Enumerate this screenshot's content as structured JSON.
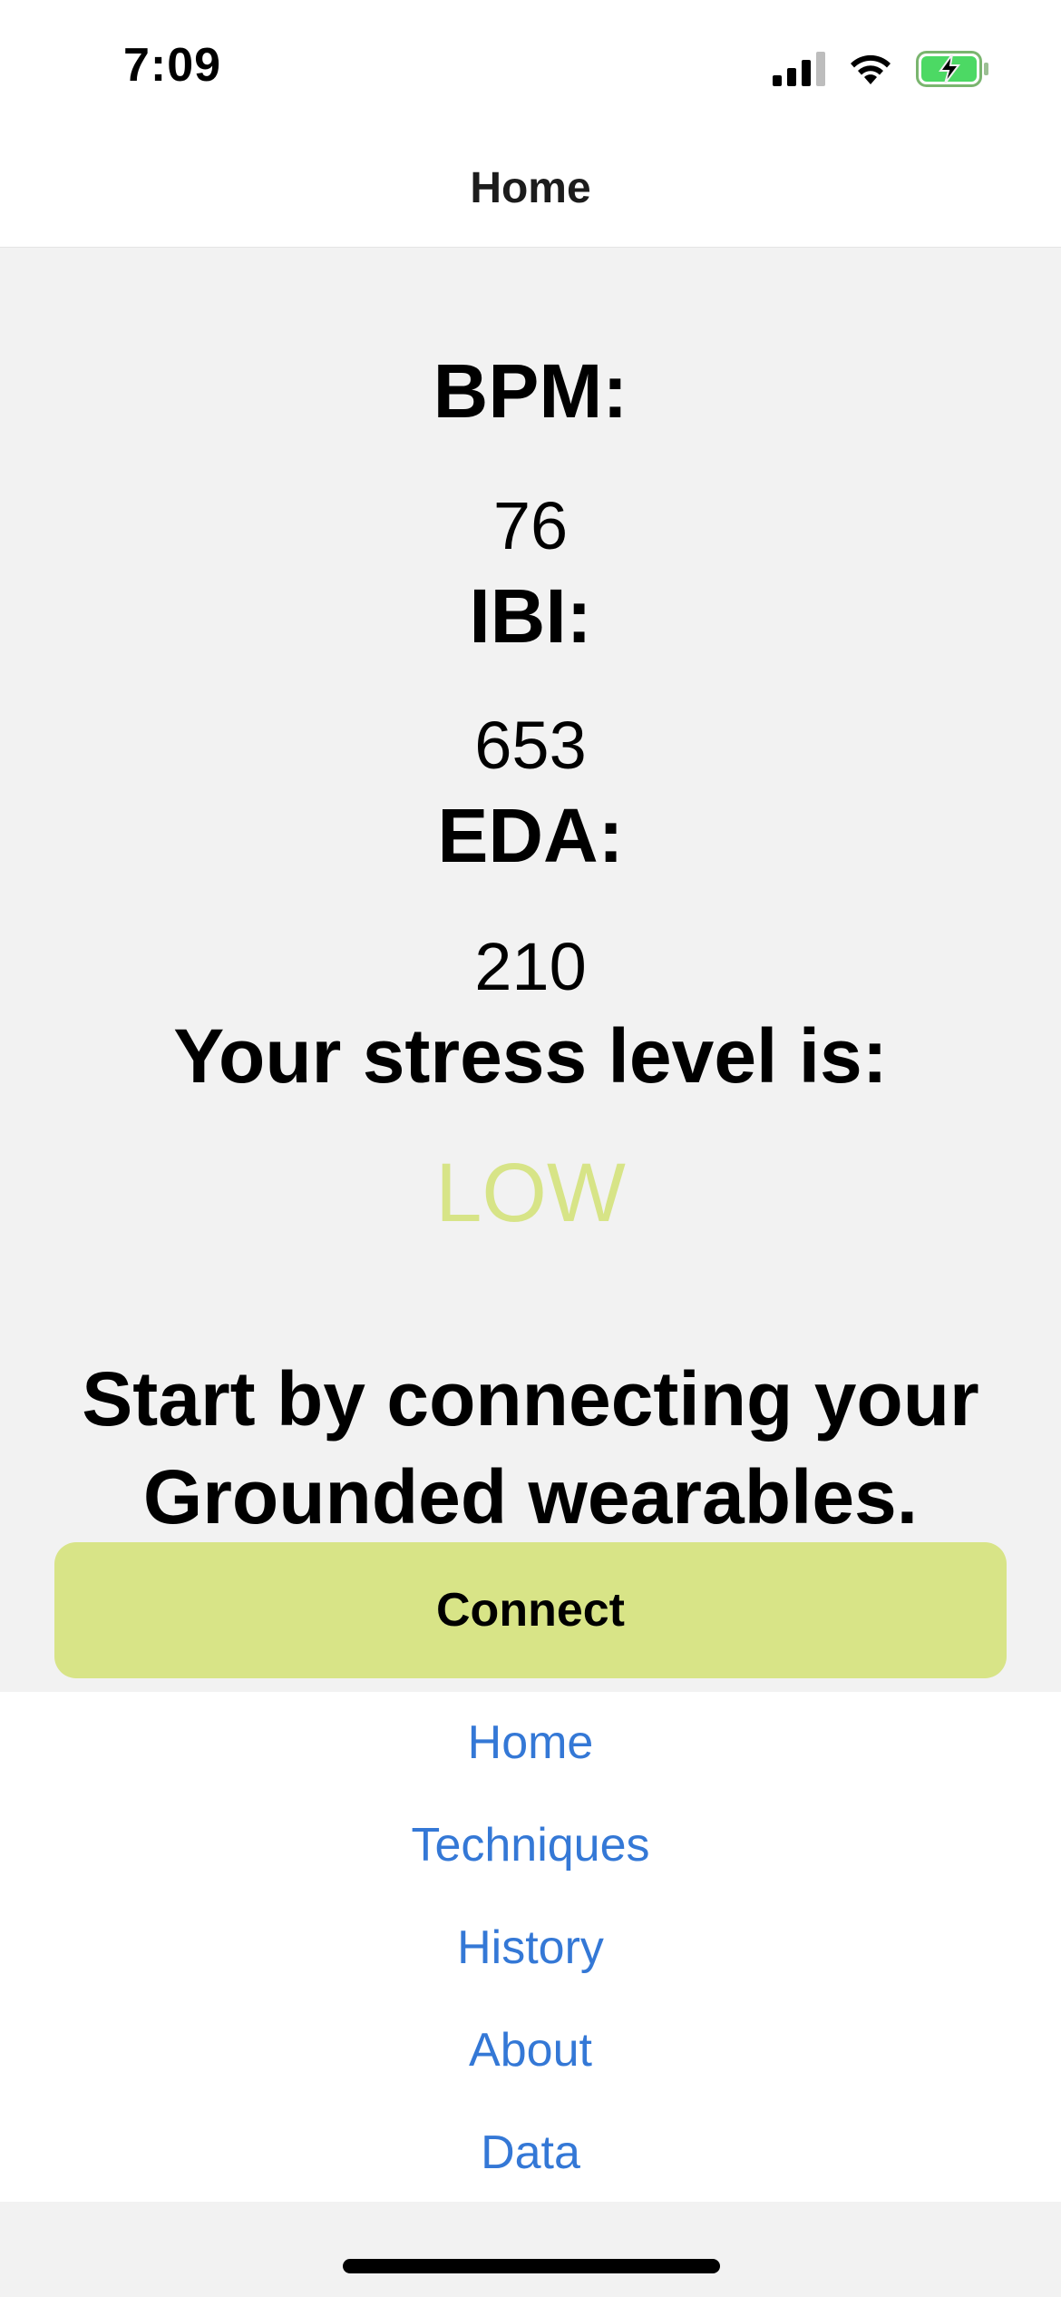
{
  "status_bar": {
    "time": "7:09",
    "signal_icon": "cellular-signal-icon",
    "wifi_icon": "wifi-icon",
    "battery_icon": "battery-charging-icon",
    "battery_color": "#4cd964"
  },
  "header": {
    "title": "Home"
  },
  "metrics": {
    "bpm_label": "BPM:",
    "bpm_value": "76",
    "ibi_label": "IBI:",
    "ibi_value": "653",
    "eda_label": "EDA:",
    "eda_value": "210"
  },
  "stress": {
    "label": "Your stress level is:",
    "value": "LOW",
    "value_color": "#d7e487"
  },
  "connect": {
    "prompt": "Start by connecting your Grounded wearables.",
    "button_label": "Connect",
    "button_color": "#d8e487"
  },
  "tabs": [
    {
      "label": "Home"
    },
    {
      "label": "Techniques"
    },
    {
      "label": "History"
    },
    {
      "label": "About"
    },
    {
      "label": "Data"
    }
  ],
  "colors": {
    "link": "#3478d6",
    "background": "#f2f2f2"
  }
}
